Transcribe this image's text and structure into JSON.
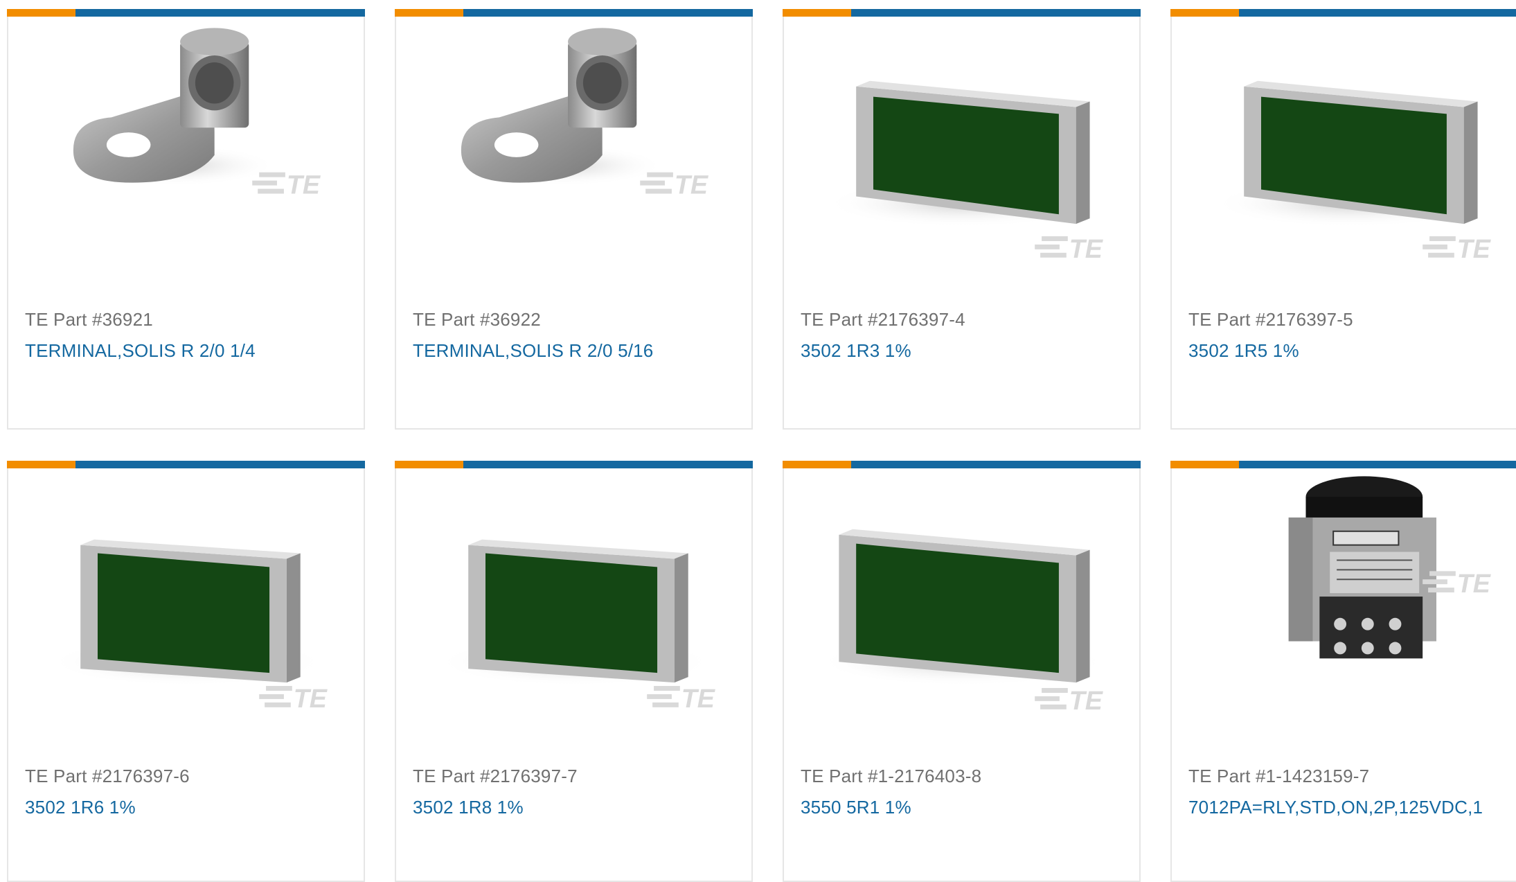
{
  "brand_colors": {
    "orange": "#f28d00",
    "blue": "#1468a0",
    "part_number_gray": "#707070"
  },
  "products": [
    {
      "part_number": "TE Part #36921",
      "description": "TERMINAL,SOLIS R 2/0 1/4",
      "image_icon": "ring-terminal-icon"
    },
    {
      "part_number": "TE Part #36922",
      "description": "TERMINAL,SOLIS R 2/0 5/16",
      "image_icon": "ring-terminal-icon"
    },
    {
      "part_number": "TE Part #2176397-4",
      "description": "3502 1R3 1%",
      "image_icon": "resistor-chip-icon"
    },
    {
      "part_number": "TE Part #2176397-5",
      "description": "3502 1R5 1%",
      "image_icon": "resistor-chip-icon"
    },
    {
      "part_number": "TE Part #2176397-6",
      "description": "3502 1R6 1%",
      "image_icon": "resistor-chip-icon"
    },
    {
      "part_number": "TE Part #2176397-7",
      "description": "3502 1R8 1%",
      "image_icon": "resistor-chip-icon"
    },
    {
      "part_number": "TE Part #1-2176403-8",
      "description": "3550 5R1 1%",
      "image_icon": "resistor-chip-icon"
    },
    {
      "part_number": "TE Part #1-1423159-7",
      "description": "7012PA=RLY,STD,ON,2P,125VDC,1",
      "image_icon": "relay-timer-icon"
    }
  ]
}
